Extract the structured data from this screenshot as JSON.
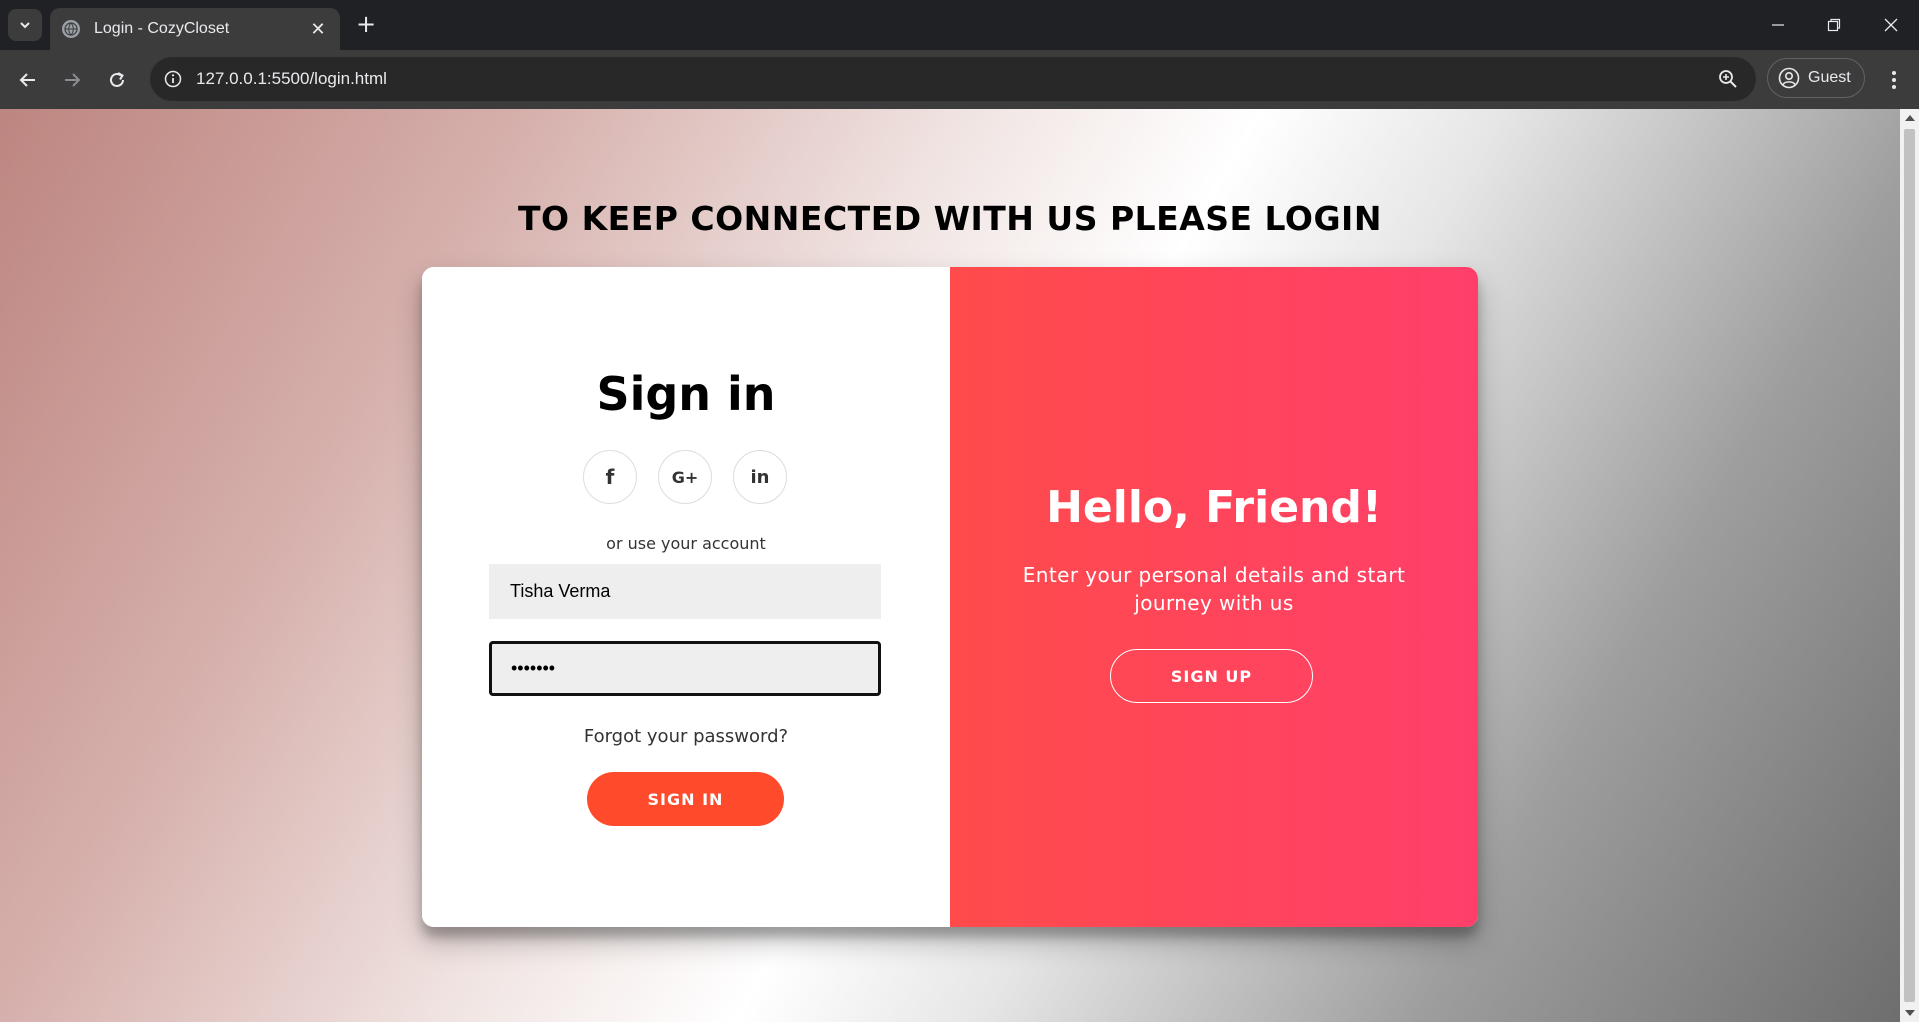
{
  "browser": {
    "tab_title": "Login - CozyCloset",
    "url": "127.0.0.1:5500/login.html",
    "profile_label": "Guest",
    "new_tab_symbol": "+",
    "close_tab_symbol": "✕"
  },
  "page": {
    "headline": "TO KEEP CONNECTED WITH US PLEASE LOGIN",
    "signin": {
      "title": "Sign in",
      "social": [
        {
          "icon": "facebook-icon",
          "glyph": "f"
        },
        {
          "icon": "google-plus-icon",
          "glyph": "G+"
        },
        {
          "icon": "linkedin-icon",
          "glyph": "in"
        }
      ],
      "alt_text": "or use your account",
      "username_value": "Tisha Verma",
      "password_value": "•••••••",
      "forgot_link": "Forgot your password?",
      "button_label": "SIGN IN"
    },
    "signup_panel": {
      "title": "Hello, Friend!",
      "subtitle": "Enter your personal details and start journey with us",
      "button_label": "SIGN UP"
    }
  },
  "colors": {
    "accent": "#ff4b2b",
    "panel_gradient_start": "#ff4b4b",
    "panel_gradient_end": "#ff3f6a",
    "chrome_dark": "#202124",
    "chrome_toolbar": "#3c3c3c"
  }
}
